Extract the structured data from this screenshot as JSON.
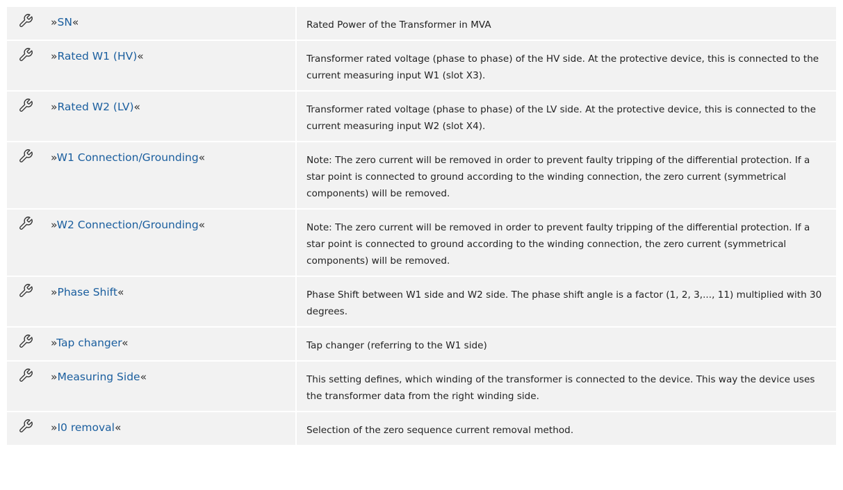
{
  "table": {
    "rows": [
      {
        "icon": "wrench-icon",
        "prefix": "»",
        "name": "SN",
        "suffix": "«",
        "description": "Rated Power of the Transformer in MVA"
      },
      {
        "icon": "wrench-icon",
        "prefix": "»",
        "name": "Rated W1 (HV)",
        "suffix": "«",
        "description": "Transformer rated voltage (phase to phase) of the HV side. At the protective device, this is connected to the current measuring input W1 (slot X3)."
      },
      {
        "icon": "wrench-icon",
        "prefix": "»",
        "name": "Rated W2 (LV)",
        "suffix": "«",
        "description": "Transformer rated voltage (phase to phase) of the LV side. At the protective device, this is connected to the current measuring input W2 (slot X4)."
      },
      {
        "icon": "wrench-icon",
        "prefix": "»",
        "name": "W1 Connection/Grounding",
        "suffix": "«",
        "description": "Note: The zero current will be removed in order to prevent faulty tripping of the differential protection. If a star point is connected to ground according to the winding connection, the zero current (symmetrical components) will be removed."
      },
      {
        "icon": "wrench-icon",
        "prefix": "»",
        "name": "W2 Connection/Grounding",
        "suffix": "«",
        "description": "Note: The zero current will be removed in order to prevent faulty tripping of the differential protection. If a star point is connected to ground according to the winding connection, the zero current (symmetrical components) will be removed."
      },
      {
        "icon": "wrench-icon",
        "prefix": "»",
        "name": "Phase Shift",
        "suffix": "«",
        "description": "Phase Shift between W1 side and W2 side. The phase shift angle is a factor (1, 2, 3,..., 11) multiplied with 30 degrees."
      },
      {
        "icon": "wrench-icon",
        "prefix": "»",
        "name": "Tap changer",
        "suffix": "«",
        "description": "Tap changer (referring to the W1 side)"
      },
      {
        "icon": "wrench-icon",
        "prefix": "»",
        "name": "Measuring Side",
        "suffix": "«",
        "description": "This setting defines, which winding of the transformer is connected to the device. This way the device uses the transformer data from the right winding side."
      },
      {
        "icon": "wrench-icon",
        "prefix": "»",
        "name": "I0 removal",
        "suffix": "«",
        "description": "Selection of the zero sequence current removal method."
      }
    ]
  },
  "colors": {
    "row_background": "#f2f2f2",
    "link": "#1a5e9e",
    "text": "#222222"
  }
}
